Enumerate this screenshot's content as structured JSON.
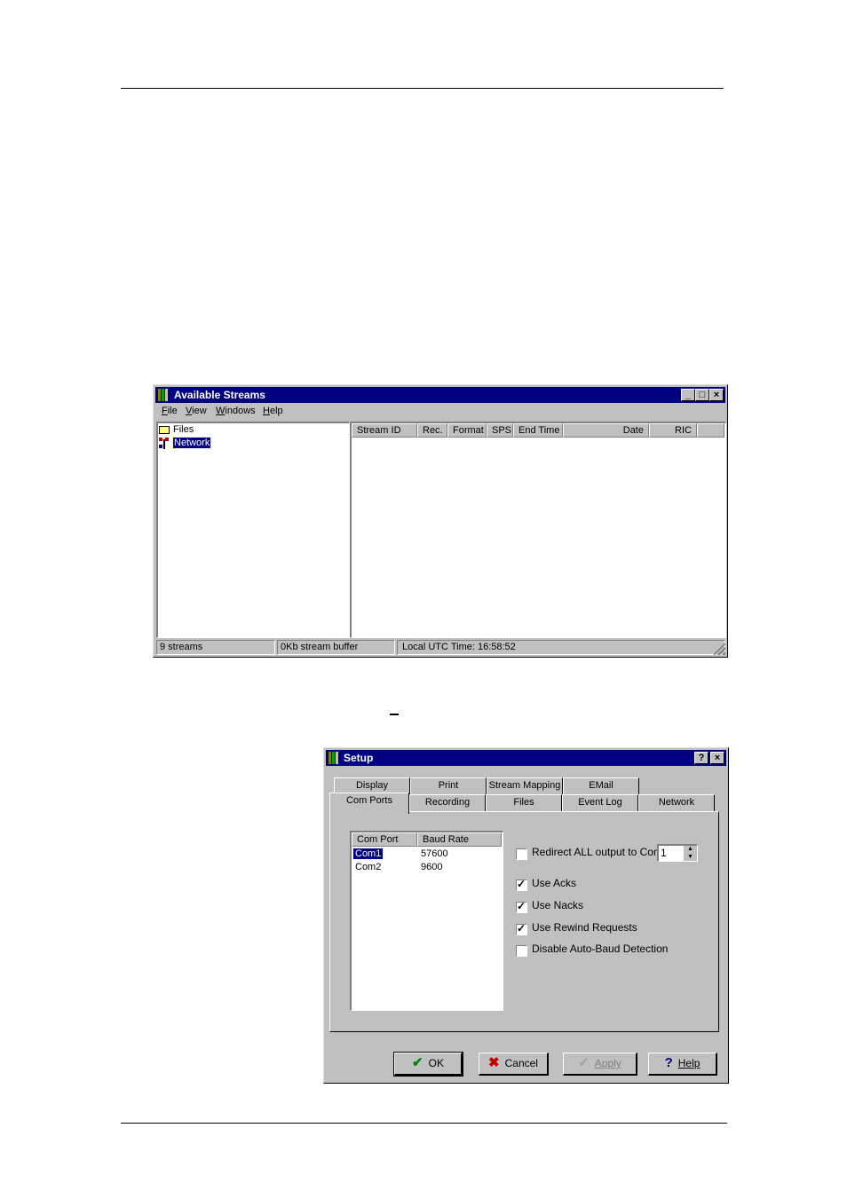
{
  "streams_window": {
    "title": "Available Streams",
    "menu": [
      "File",
      "View",
      "Windows",
      "Help"
    ],
    "tree": [
      {
        "label": "Files",
        "icon": "folder-icon"
      },
      {
        "label": "Network",
        "icon": "network-icon",
        "selected": true
      }
    ],
    "columns": [
      "Stream ID",
      "Rec.",
      "Format",
      "SPS",
      "End Time",
      "Date",
      "RIC"
    ],
    "status": [
      "9 streams",
      "0Kb stream buffer",
      "Local UTC Time:  16:58:52"
    ]
  },
  "setup_dialog": {
    "title": "Setup",
    "tabs_back": [
      "Display",
      "Print",
      "Stream Mapping",
      "EMail"
    ],
    "tabs_front": [
      "Com Ports",
      "Recording",
      "Files",
      "Event Log",
      "Network"
    ],
    "active_tab": "Com Ports",
    "list_columns": [
      "Com Port",
      "Baud Rate"
    ],
    "ports": [
      {
        "port": "Com1",
        "baud": "57600",
        "selected": true
      },
      {
        "port": "Com2",
        "baud": "9600",
        "selected": false
      }
    ],
    "redirect": {
      "label": "Redirect ALL output to Com",
      "checked": false,
      "value": "1"
    },
    "options": [
      {
        "label": "Use Acks",
        "checked": true
      },
      {
        "label": "Use Nacks",
        "checked": true
      },
      {
        "label": "Use Rewind Requests",
        "checked": true
      },
      {
        "label": "Disable Auto-Baud Detection",
        "checked": false
      }
    ],
    "buttons": {
      "ok": "OK",
      "cancel": "Cancel",
      "apply": "Apply",
      "help": "Help"
    }
  }
}
